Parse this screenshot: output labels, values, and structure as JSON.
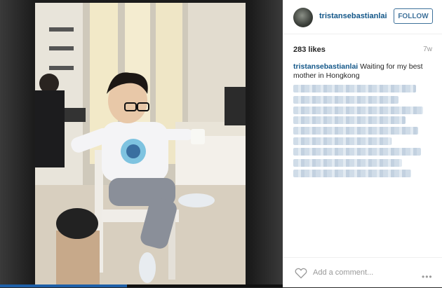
{
  "post": {
    "username": "tristansebastianlai",
    "follow_label": "FOLLOW",
    "likes": "283 likes",
    "age": "7w",
    "caption_user": "tristansebastianlai",
    "caption_text": "Waiting for my best mother in Hongkong",
    "comment_placeholder": "Add a comment...",
    "more_label": "•••"
  },
  "video": {
    "progress": 0.45
  },
  "colors": {
    "link": "#125688",
    "button": "#3f729b",
    "progress": "#1d5fa8"
  }
}
